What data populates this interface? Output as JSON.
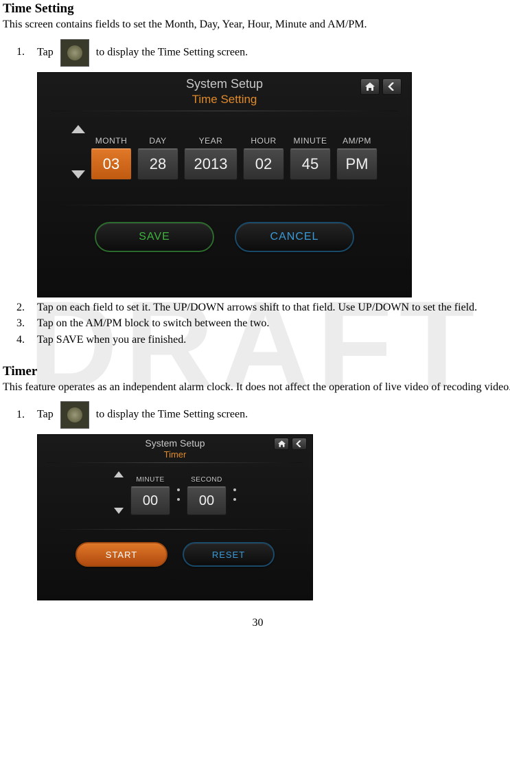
{
  "section1": {
    "title": "Time Setting",
    "intro": "This screen contains fields to set the Month, Day, Year, Hour, Minute and AM/PM.",
    "step1_pre": "Tap",
    "step1_post": " to display the Time Setting screen.",
    "step2": "Tap on each field to set it. The UP/DOWN arrows shift to that field. Use UP/DOWN to set the field.",
    "step3": "Tap on the AM/PM block to switch between the two.",
    "step4": "Tap SAVE when you are finished."
  },
  "screen1": {
    "sys": "System Setup",
    "sub": "Time Setting",
    "labels": {
      "month": "MONTH",
      "day": "DAY",
      "year": "YEAR",
      "hour": "HOUR",
      "minute": "MINUTE",
      "ampm": "AM/PM"
    },
    "values": {
      "month": "03",
      "day": "28",
      "year": "2013",
      "hour": "02",
      "minute": "45",
      "ampm": "PM"
    },
    "save": "SAVE",
    "cancel": "CANCEL"
  },
  "section2": {
    "title": "Timer",
    "intro": "This feature operates as an independent alarm clock. It does not affect the operation of live video of recoding video.",
    "step1_pre": "Tap",
    "step1_post": " to display the Time Setting screen."
  },
  "screen2": {
    "sys": "System Setup",
    "sub": "Timer",
    "labels": {
      "minute": "MINUTE",
      "second": "SECOND"
    },
    "values": {
      "minute": "00",
      "second": "00"
    },
    "start": "START",
    "reset": "RESET"
  },
  "watermark": "DRAFT",
  "page": "30"
}
